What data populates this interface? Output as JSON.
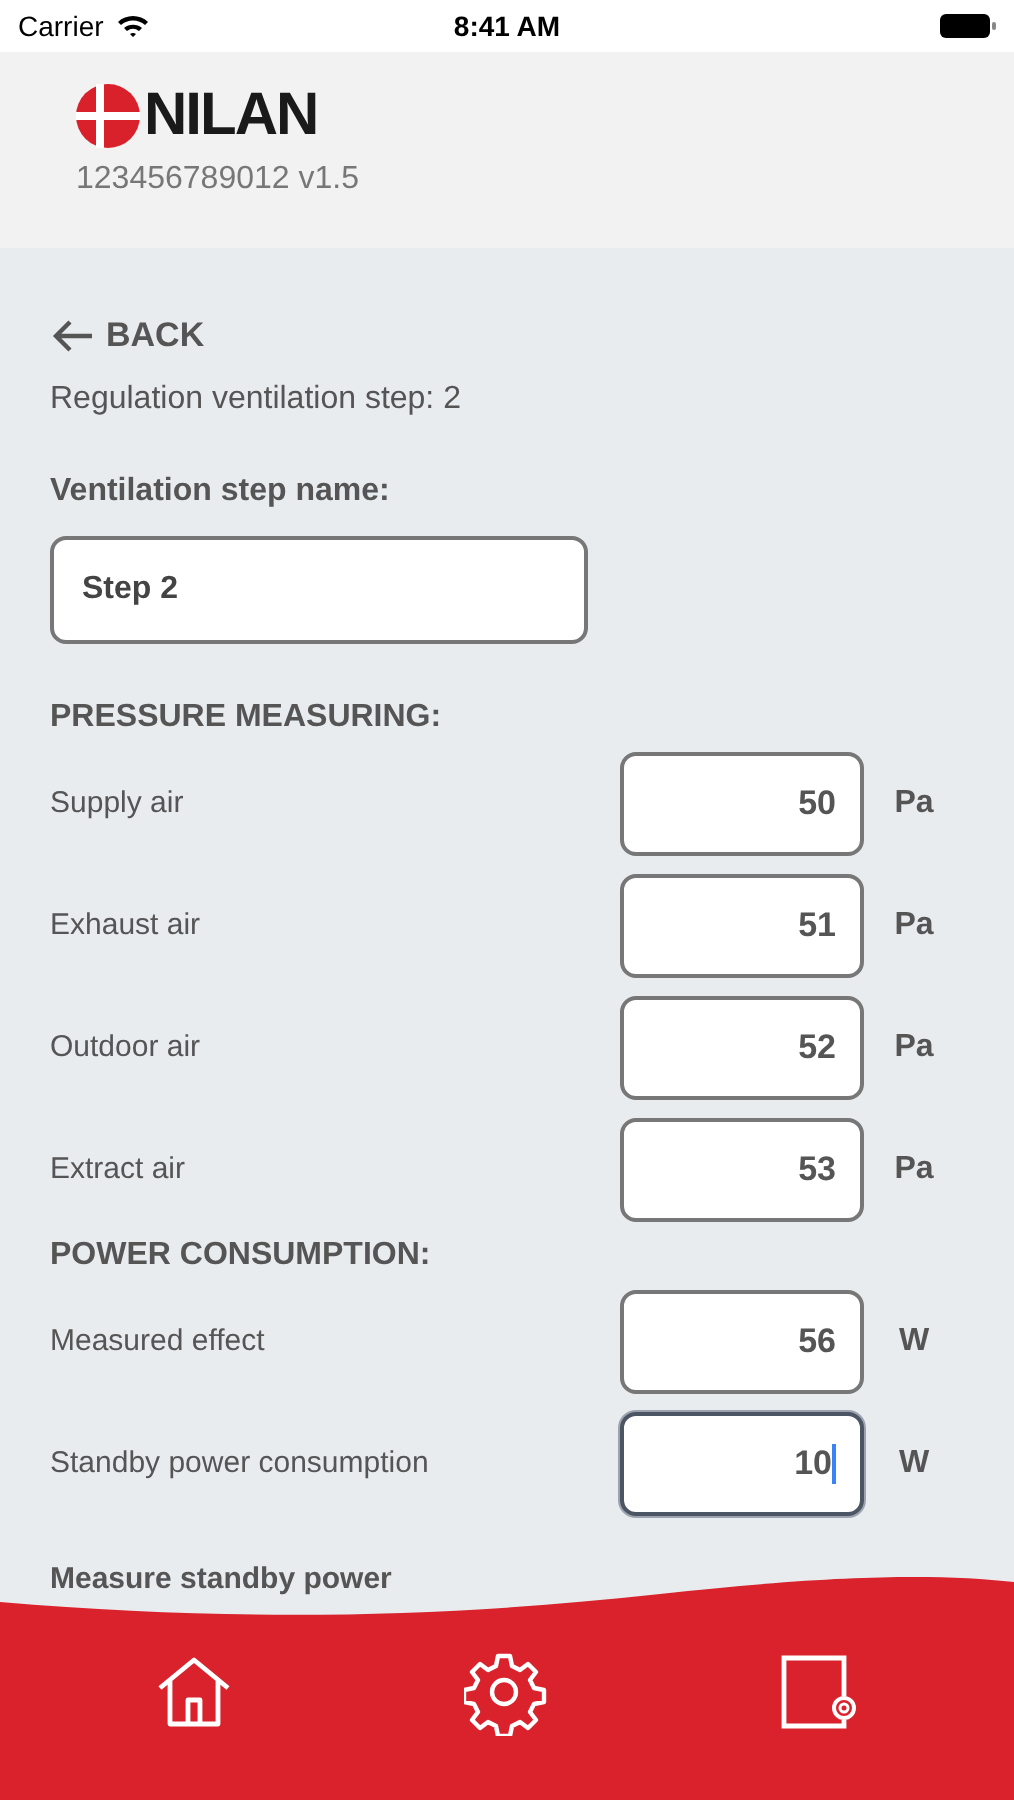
{
  "status_bar": {
    "carrier": "Carrier",
    "time": "8:41 AM"
  },
  "header": {
    "logo": "NILAN",
    "device": "123456789012 v1.5"
  },
  "back": "BACK",
  "subtitle": "Regulation ventilation step: 2",
  "name_field": {
    "label": "Ventilation step name:",
    "value": "Step 2"
  },
  "sections": [
    {
      "title": "PRESSURE MEASURING:",
      "rows": [
        {
          "label": "Supply air",
          "value": "50",
          "unit": "Pa",
          "focused": false
        },
        {
          "label": "Exhaust air",
          "value": "51",
          "unit": "Pa",
          "focused": false
        },
        {
          "label": "Outdoor air",
          "value": "52",
          "unit": "Pa",
          "focused": false
        },
        {
          "label": "Extract air",
          "value": "53",
          "unit": "Pa",
          "focused": false
        }
      ]
    },
    {
      "title": "POWER CONSUMPTION:",
      "rows": [
        {
          "label": "Measured effect",
          "value": "56",
          "unit": "W",
          "focused": false
        },
        {
          "label": "Standby power consumption",
          "value": "10",
          "unit": "W",
          "focused": true
        }
      ]
    }
  ],
  "partial_heading": "Measure standby power",
  "tab_bar": [
    {
      "kind": "home"
    },
    {
      "kind": "settings"
    },
    {
      "kind": "device-settings"
    }
  ]
}
